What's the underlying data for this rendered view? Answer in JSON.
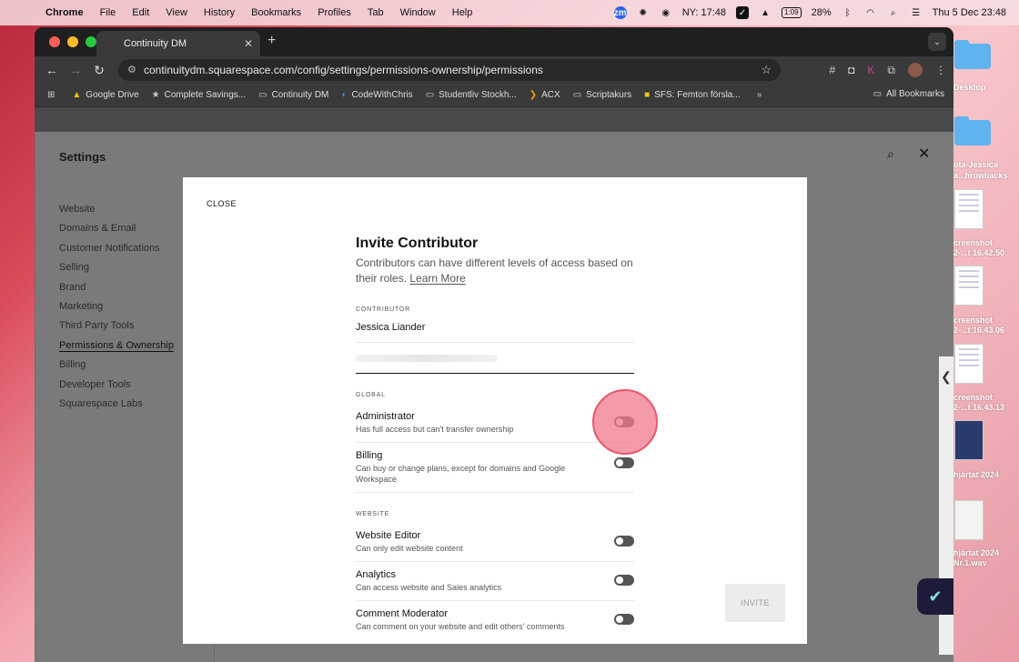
{
  "menubar": {
    "app": "Chrome",
    "items": [
      "File",
      "Edit",
      "View",
      "History",
      "Bookmarks",
      "Profiles",
      "Tab",
      "Window",
      "Help"
    ],
    "clock_city": "NY: 17:48",
    "battery_time": "1:09",
    "battery_percent": "28%",
    "datetime": "Thu 5 Dec  23:48"
  },
  "desktop": {
    "items": [
      "Desktop",
      "ota-Jessica",
      "a...hrowbacks",
      "creenshot",
      "2-...t 16.42.50",
      "creenshot",
      "2-...t 16.43.06",
      "creenshot",
      "2-...t 16.43.13",
      "hjärtat 2024",
      "hjärtat 2024",
      "Nr.1.wav"
    ]
  },
  "browser": {
    "tab_title": "Continuity DM",
    "url": "continuitydm.squarespace.com/config/settings/permissions-ownership/permissions",
    "bookmarks": [
      "Google Drive",
      "Complete Savings...",
      "Continuity DM",
      "CodeWithChris",
      "Studentliv Stockh...",
      "ACX",
      "Scriptakurs",
      "SFS: Femton försla..."
    ],
    "all_bookmarks": "All Bookmarks"
  },
  "settings": {
    "title": "Settings",
    "nav": [
      "Website",
      "Domains & Email",
      "Customer Notifications",
      "Selling",
      "Brand",
      "Marketing",
      "Third Party Tools",
      "Permissions & Ownership",
      "Billing",
      "Developer Tools",
      "Squarespace Labs"
    ]
  },
  "modal": {
    "close_label": "CLOSE",
    "title": "Invite Contributor",
    "subtitle": "Contributors can have different levels of access based on their roles.",
    "learn_more": "Learn More",
    "contributor_label": "CONTRIBUTOR",
    "contributor_name": "Jessica Liander",
    "global_label": "GLOBAL",
    "website_label": "WEBSITE",
    "permissions": {
      "administrator": {
        "name": "Administrator",
        "desc": "Has full access but can't transfer ownership"
      },
      "billing": {
        "name": "Billing",
        "desc": "Can buy or change plans, except for domains and Google Workspace"
      },
      "website_editor": {
        "name": "Website Editor",
        "desc": "Can only edit website content"
      },
      "analytics": {
        "name": "Analytics",
        "desc": "Can access website and Sales analytics"
      },
      "comment_moderator": {
        "name": "Comment Moderator",
        "desc": "Can comment on your website and edit others' comments"
      }
    },
    "invite_label": "INVITE"
  }
}
